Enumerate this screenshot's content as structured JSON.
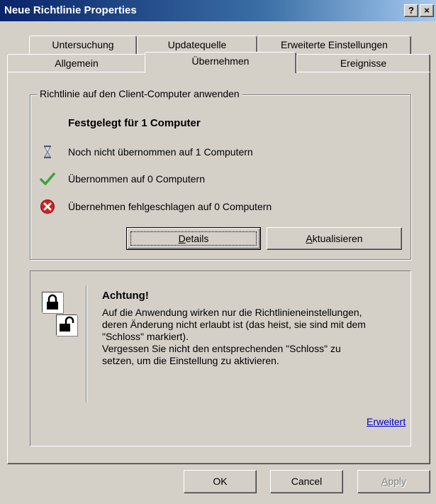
{
  "window": {
    "title": "Neue Richtlinie Properties",
    "help_label": "?",
    "close_label": "×"
  },
  "tabs": {
    "row1": [
      "Untersuchung",
      "Updatequelle",
      "Erweiterte Einstellungen"
    ],
    "row2": [
      "Allgemein",
      "Übernehmen",
      "Ereignisse"
    ],
    "active": "Übernehmen"
  },
  "apply_group": {
    "legend": "Richtlinie auf den Client-Computer anwenden",
    "heading": "Festgelegt für 1 Computer",
    "statuses": [
      {
        "icon": "hourglass-icon",
        "text": "Noch nicht übernommen auf 1 Computern"
      },
      {
        "icon": "green-check-icon",
        "text": "Übernommen auf 0 Computern"
      },
      {
        "icon": "red-error-icon",
        "text": "Übernehmen fehlgeschlagen auf 0 Computern"
      }
    ],
    "details_button": {
      "accel": "D",
      "rest": "etails"
    },
    "refresh_button": {
      "accel": "A",
      "rest": "ktualisieren"
    }
  },
  "warning": {
    "title": "Achtung!",
    "lines": [
      "Auf die Anwendung wirken nur die Richtlinieneinstellungen,",
      "deren Änderung nicht erlaubt ist (das heist, sie sind mit dem",
      "\"Schloss\" markiert).",
      "Vergessen Sie nicht den entsprechenden \"Schloss\" zu",
      "setzen, um die Einstellung zu aktivieren."
    ],
    "link": "Erweitert",
    "icons": [
      "locked-icon",
      "unlocked-icon"
    ]
  },
  "footer": {
    "ok": "OK",
    "cancel": "Cancel",
    "apply": {
      "accel": "A",
      "rest": "pply"
    },
    "apply_enabled": false
  },
  "colors": {
    "title_start": "#0a246a",
    "title_end": "#a6caf0",
    "face": "#d4d0c8",
    "link": "#0000cc",
    "check": "#3aa63a",
    "error": "#d42020"
  }
}
